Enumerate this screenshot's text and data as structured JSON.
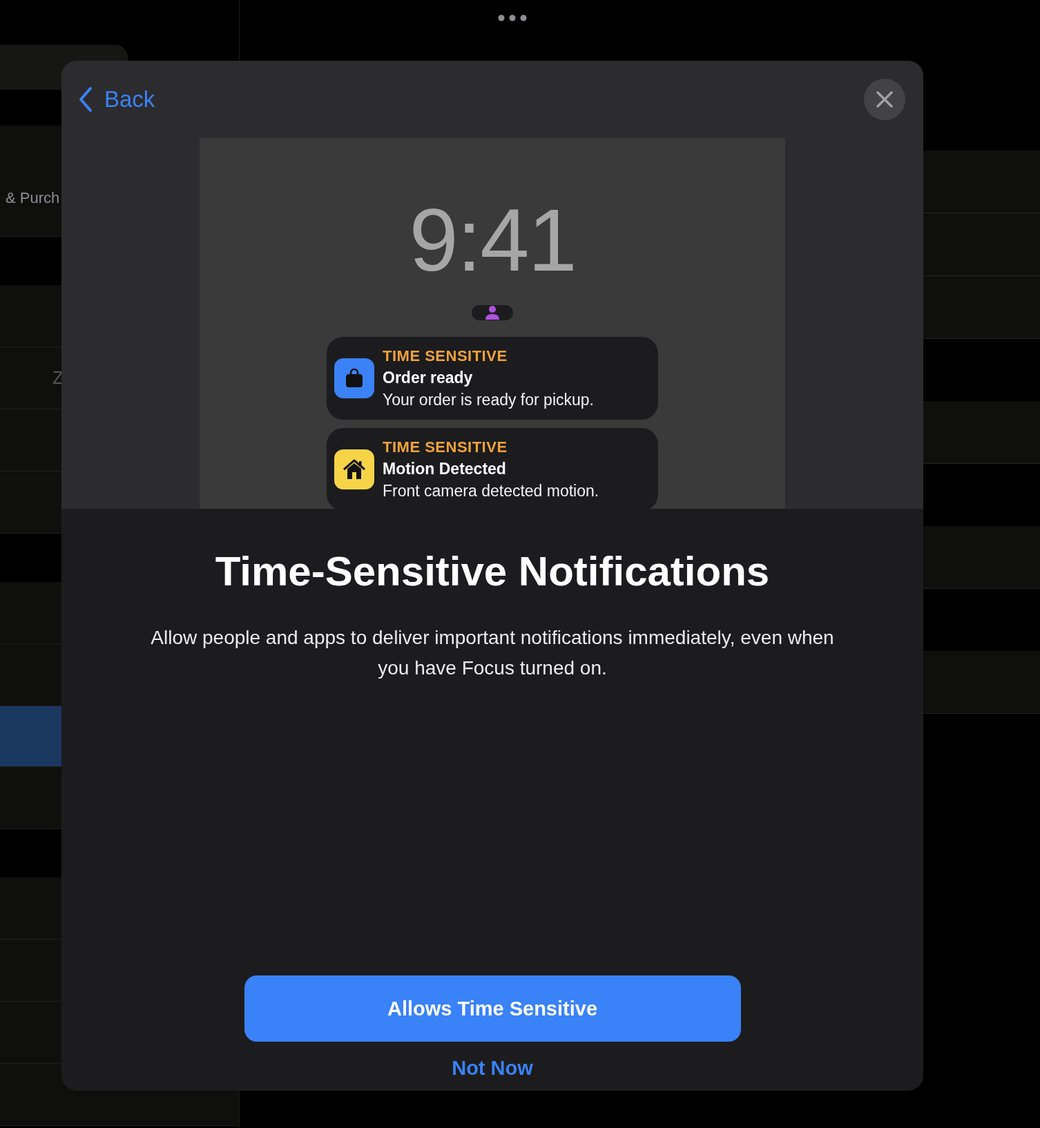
{
  "background": {
    "left_rows": [
      {
        "kind": "top"
      },
      {
        "kind": "field"
      },
      {
        "kind": "spacer"
      },
      {
        "kind": "tall",
        "label": "& Purch"
      },
      {
        "kind": "gap"
      },
      {
        "kind": "row"
      },
      {
        "kind": "row",
        "label": "Z"
      },
      {
        "kind": "row"
      },
      {
        "kind": "row"
      },
      {
        "kind": "gap"
      },
      {
        "kind": "row"
      },
      {
        "kind": "row"
      },
      {
        "kind": "selected"
      },
      {
        "kind": "row"
      },
      {
        "kind": "gap"
      },
      {
        "kind": "row"
      },
      {
        "kind": "row"
      },
      {
        "kind": "row"
      },
      {
        "kind": "row"
      }
    ],
    "right_rows": [
      {
        "kind": "top"
      },
      {
        "kind": "row"
      },
      {
        "kind": "row"
      },
      {
        "kind": "row"
      },
      {
        "kind": "gap"
      },
      {
        "kind": "row"
      },
      {
        "kind": "gap"
      },
      {
        "kind": "row"
      },
      {
        "kind": "gap"
      },
      {
        "kind": "row"
      }
    ]
  },
  "sheet": {
    "back_label": "Back",
    "preview": {
      "time": "9:41",
      "notifications": [
        {
          "kind": "bag",
          "color": "#3b82f6",
          "label": "TIME SENSITIVE",
          "title": "Order ready",
          "body": "Your order is ready for pickup."
        },
        {
          "kind": "home",
          "color": "#f7d447",
          "label": "TIME SENSITIVE",
          "title": "Motion Detected",
          "body": "Front camera detected motion."
        }
      ]
    },
    "title": "Time-Sensitive Notifications",
    "description": "Allow people and apps to deliver important notifications immediately, even when you have Focus turned on.",
    "primary_button": "Allows Time Sensitive",
    "secondary_button": "Not Now"
  }
}
